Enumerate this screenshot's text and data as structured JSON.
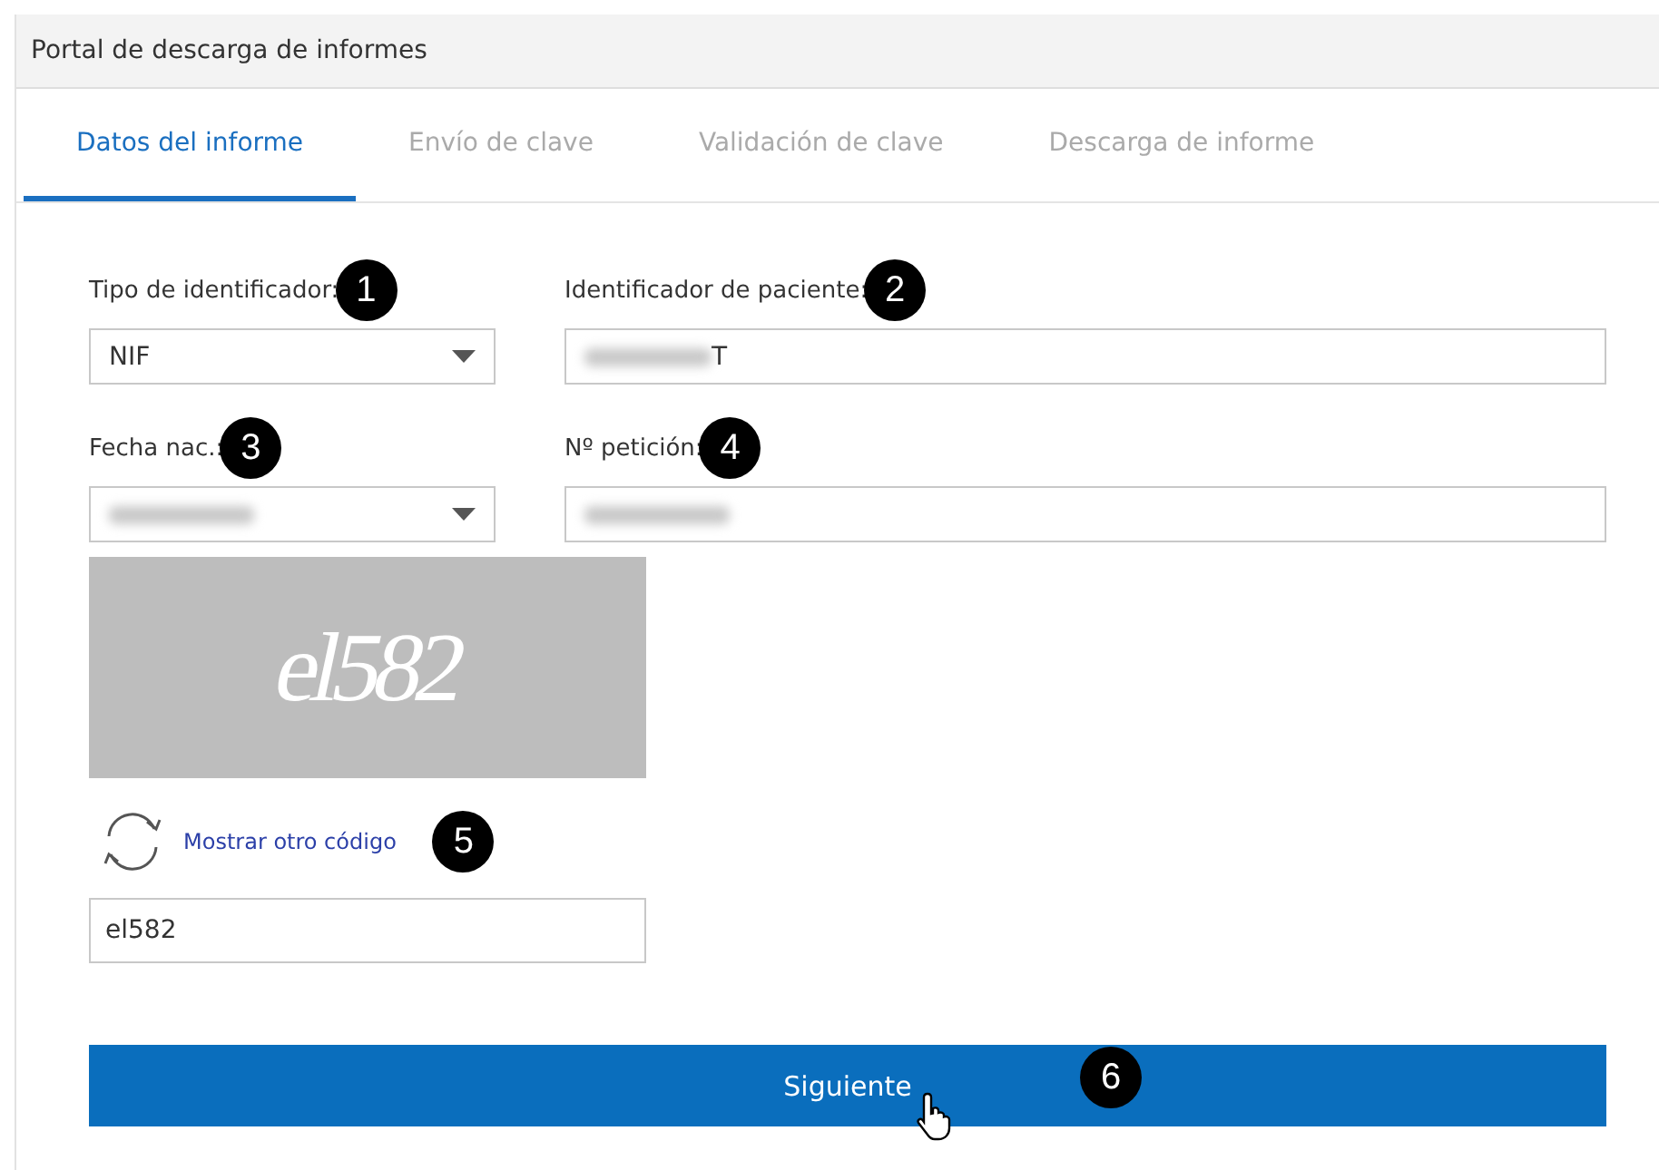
{
  "header": {
    "title": "Portal de descarga de informes"
  },
  "tabs": [
    {
      "label": "Datos del informe",
      "selected": true
    },
    {
      "label": "Envío de clave",
      "selected": false
    },
    {
      "label": "Validación de clave",
      "selected": false
    },
    {
      "label": "Descarga de informe",
      "selected": false
    }
  ],
  "form": {
    "fields": [
      {
        "kind": "select",
        "label": "Tipo de identificador:",
        "value": "NIF",
        "callout": "1"
      },
      {
        "kind": "text",
        "label": "Identificador de paciente:",
        "value": "T",
        "redacted": true,
        "callout": "2"
      },
      {
        "kind": "select",
        "label": "Fecha nac.:",
        "redacted": true,
        "callout": "3"
      },
      {
        "kind": "text",
        "label": "Nº petición:",
        "redacted": true,
        "callout": "4"
      }
    ],
    "captcha": {
      "text": "el582"
    },
    "refresh_link": {
      "label": "Mostrar otro código",
      "callout": "5"
    },
    "code_field": {
      "value": "el582"
    },
    "submit": {
      "label": "Siguiente",
      "callout": "6"
    }
  }
}
